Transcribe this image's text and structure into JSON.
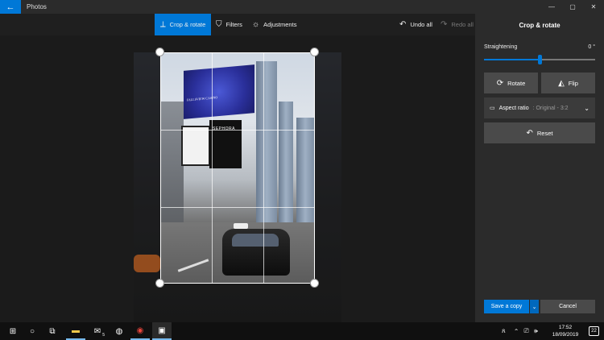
{
  "titlebar": {
    "app_title": "Photos",
    "back_icon": "←",
    "minimize_icon": "—",
    "maximize_icon": "▢",
    "close_icon": "✕"
  },
  "toolbar": {
    "crop_label": "Crop & rotate",
    "filters_label": "Filters",
    "adjustments_label": "Adjustments",
    "undo_label": "Undo all",
    "redo_label": "Redo all",
    "accent": "#0078d7"
  },
  "photo": {
    "billboard_text": "FALLSVIEW CASINO",
    "sephora_text": "SEPHORA"
  },
  "panel": {
    "title": "Crop & rotate",
    "straightening_label": "Straightening",
    "straightening_value": "0 °",
    "straightening_level": 0.5,
    "rotate_label": "Rotate",
    "flip_label": "Flip",
    "aspect_label": "Aspect ratio",
    "aspect_value": ": Original - 3:2",
    "reset_label": "Reset",
    "save_label": "Save a copy",
    "cancel_label": "Cancel"
  },
  "taskbar": {
    "time": "17:52",
    "date": "18/09/2019",
    "notification_count": "22",
    "mail_badge": "5"
  }
}
